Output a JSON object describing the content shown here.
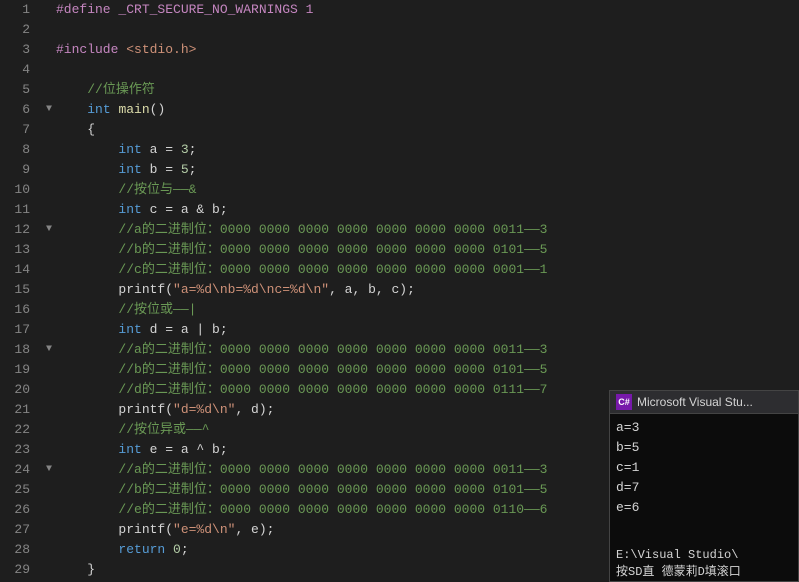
{
  "editor": {
    "lines": [
      {
        "num": 1,
        "fold": "",
        "content": [
          {
            "t": "#define _CRT_SECURE_NO_WARNINGS 1",
            "c": "pp"
          }
        ]
      },
      {
        "num": 2,
        "fold": "",
        "content": []
      },
      {
        "num": 3,
        "fold": "",
        "content": [
          {
            "t": "#include ",
            "c": "pp"
          },
          {
            "t": "<stdio.h>",
            "c": "inc"
          }
        ]
      },
      {
        "num": 4,
        "fold": "",
        "content": []
      },
      {
        "num": 5,
        "fold": "",
        "content": [
          {
            "t": "    ",
            "c": "plain"
          },
          {
            "t": "//位操作符",
            "c": "cm"
          }
        ]
      },
      {
        "num": 6,
        "fold": "fold",
        "content": [
          {
            "t": "    ",
            "c": "plain"
          },
          {
            "t": "int",
            "c": "kw"
          },
          {
            "t": " ",
            "c": "plain"
          },
          {
            "t": "main",
            "c": "fn"
          },
          {
            "t": "()",
            "c": "plain"
          }
        ]
      },
      {
        "num": 7,
        "fold": "",
        "content": [
          {
            "t": "    {",
            "c": "plain"
          }
        ]
      },
      {
        "num": 8,
        "fold": "",
        "content": [
          {
            "t": "        ",
            "c": "plain"
          },
          {
            "t": "int",
            "c": "kw"
          },
          {
            "t": " a = ",
            "c": "plain"
          },
          {
            "t": "3",
            "c": "num"
          },
          {
            "t": ";",
            "c": "plain"
          }
        ]
      },
      {
        "num": 9,
        "fold": "",
        "content": [
          {
            "t": "        ",
            "c": "plain"
          },
          {
            "t": "int",
            "c": "kw"
          },
          {
            "t": " b = ",
            "c": "plain"
          },
          {
            "t": "5",
            "c": "num"
          },
          {
            "t": ";",
            "c": "plain"
          }
        ]
      },
      {
        "num": 10,
        "fold": "",
        "content": [
          {
            "t": "        ",
            "c": "plain"
          },
          {
            "t": "//按位与——&",
            "c": "cm"
          }
        ]
      },
      {
        "num": 11,
        "fold": "",
        "content": [
          {
            "t": "        ",
            "c": "plain"
          },
          {
            "t": "int",
            "c": "kw"
          },
          {
            "t": " c = a & b;",
            "c": "plain"
          }
        ]
      },
      {
        "num": 12,
        "fold": "fold",
        "content": [
          {
            "t": "        ",
            "c": "plain"
          },
          {
            "t": "//a的二进制位：0000 0000 0000 0000 0000 0000 0000 0011——3",
            "c": "cm"
          }
        ]
      },
      {
        "num": 13,
        "fold": "",
        "content": [
          {
            "t": "        ",
            "c": "plain"
          },
          {
            "t": "//b的二进制位：0000 0000 0000 0000 0000 0000 0000 0101——5",
            "c": "cm"
          }
        ]
      },
      {
        "num": 14,
        "fold": "",
        "content": [
          {
            "t": "        ",
            "c": "plain"
          },
          {
            "t": "//c的二进制位：0000 0000 0000 0000 0000 0000 0000 0001——1",
            "c": "cm"
          }
        ]
      },
      {
        "num": 15,
        "fold": "",
        "content": [
          {
            "t": "        ",
            "c": "plain"
          },
          {
            "t": "printf(",
            "c": "plain"
          },
          {
            "t": "\"a=%d\\nb=%d\\nc=%d\\n\"",
            "c": "str"
          },
          {
            "t": ", a, b, c);",
            "c": "plain"
          }
        ]
      },
      {
        "num": 16,
        "fold": "",
        "content": [
          {
            "t": "        ",
            "c": "plain"
          },
          {
            "t": "//按位或——|",
            "c": "cm"
          }
        ]
      },
      {
        "num": 17,
        "fold": "",
        "content": [
          {
            "t": "        ",
            "c": "plain"
          },
          {
            "t": "int",
            "c": "kw"
          },
          {
            "t": " d = a | b;",
            "c": "plain"
          }
        ]
      },
      {
        "num": 18,
        "fold": "fold",
        "content": [
          {
            "t": "        ",
            "c": "plain"
          },
          {
            "t": "//a的二进制位：0000 0000 0000 0000 0000 0000 0000 0011——3",
            "c": "cm"
          }
        ]
      },
      {
        "num": 19,
        "fold": "",
        "content": [
          {
            "t": "        ",
            "c": "plain"
          },
          {
            "t": "//b的二进制位：0000 0000 0000 0000 0000 0000 0000 0101——5",
            "c": "cm"
          }
        ]
      },
      {
        "num": 20,
        "fold": "",
        "content": [
          {
            "t": "        ",
            "c": "plain"
          },
          {
            "t": "//d的二进制位：0000 0000 0000 0000 0000 0000 0000 0111——7",
            "c": "cm"
          }
        ]
      },
      {
        "num": 21,
        "fold": "",
        "content": [
          {
            "t": "        ",
            "c": "plain"
          },
          {
            "t": "printf(",
            "c": "plain"
          },
          {
            "t": "\"d=%d\\n\"",
            "c": "str"
          },
          {
            "t": ", d);",
            "c": "plain"
          }
        ]
      },
      {
        "num": 22,
        "fold": "",
        "content": [
          {
            "t": "        ",
            "c": "plain"
          },
          {
            "t": "//按位异或——^",
            "c": "cm"
          }
        ]
      },
      {
        "num": 23,
        "fold": "",
        "content": [
          {
            "t": "        ",
            "c": "plain"
          },
          {
            "t": "int",
            "c": "kw"
          },
          {
            "t": " e = a ^ b;",
            "c": "plain"
          }
        ]
      },
      {
        "num": 24,
        "fold": "fold",
        "content": [
          {
            "t": "        ",
            "c": "plain"
          },
          {
            "t": "//a的二进制位：0000 0000 0000 0000 0000 0000 0000 0011——3",
            "c": "cm"
          }
        ]
      },
      {
        "num": 25,
        "fold": "",
        "content": [
          {
            "t": "        ",
            "c": "plain"
          },
          {
            "t": "//b的二进制位：0000 0000 0000 0000 0000 0000 0000 0101——5",
            "c": "cm"
          }
        ]
      },
      {
        "num": 26,
        "fold": "",
        "content": [
          {
            "t": "        ",
            "c": "plain"
          },
          {
            "t": "//e的二进制位：0000 0000 0000 0000 0000 0000 0000 0110——6",
            "c": "cm"
          }
        ]
      },
      {
        "num": 27,
        "fold": "",
        "content": [
          {
            "t": "        ",
            "c": "plain"
          },
          {
            "t": "printf(",
            "c": "plain"
          },
          {
            "t": "\"e=%d\\n\"",
            "c": "str"
          },
          {
            "t": ", e);",
            "c": "plain"
          }
        ]
      },
      {
        "num": 28,
        "fold": "",
        "content": [
          {
            "t": "        ",
            "c": "plain"
          },
          {
            "t": "return ",
            "c": "kw"
          },
          {
            "t": "0",
            "c": "num"
          },
          {
            "t": ";",
            "c": "plain"
          }
        ]
      },
      {
        "num": 29,
        "fold": "",
        "content": [
          {
            "t": "    }",
            "c": "plain"
          }
        ]
      }
    ]
  },
  "output": {
    "title": "Microsoft Visual Stu...",
    "icon": "C#",
    "lines": [
      "a=3",
      "b=5",
      "c=1",
      "d=7",
      "e=6"
    ],
    "footer": "E:\\Visual Studio\\",
    "footer2": "按SD直 德蒙莉D填滚口"
  }
}
